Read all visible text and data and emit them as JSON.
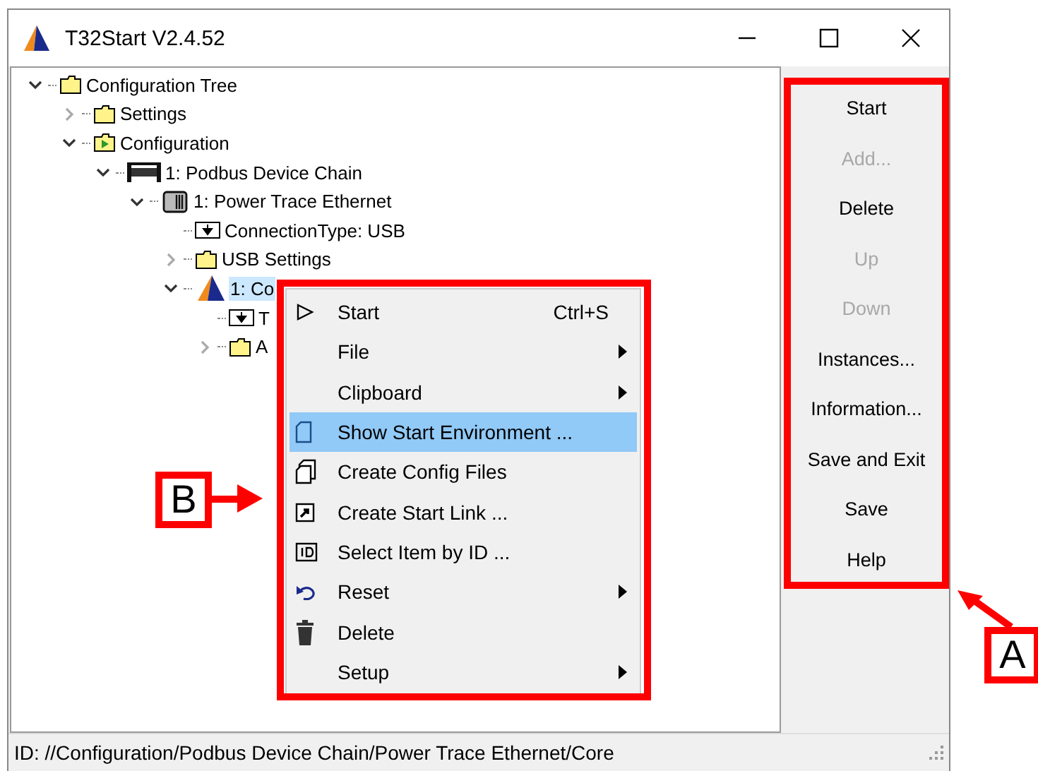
{
  "window": {
    "title": "T32Start V2.4.52"
  },
  "tree": [
    {
      "label": "Configuration Tree",
      "kind": "folder",
      "expanded": true,
      "selected": false,
      "children": [
        {
          "label": "Settings",
          "kind": "folder",
          "expanded": false,
          "selected": false
        },
        {
          "label": "Configuration",
          "kind": "folder-run",
          "expanded": true,
          "selected": false,
          "children": [
            {
              "label": "1: Podbus Device Chain",
              "kind": "chain",
              "expanded": true,
              "selected": false,
              "children": [
                {
                  "label": "1: Power Trace Ethernet",
                  "kind": "device",
                  "expanded": true,
                  "selected": false,
                  "children": [
                    {
                      "label": "ConnectionType: USB",
                      "kind": "setting",
                      "selected": false
                    },
                    {
                      "label": "USB Settings",
                      "kind": "folder",
                      "expanded": false,
                      "selected": false
                    },
                    {
                      "label": "1: Co",
                      "kind": "core",
                      "expanded": true,
                      "selected": true,
                      "children": [
                        {
                          "label": "T",
                          "kind": "setting",
                          "selected": false
                        },
                        {
                          "label": "A",
                          "kind": "folder",
                          "expanded": false,
                          "selected": false
                        }
                      ]
                    }
                  ]
                }
              ]
            }
          ]
        }
      ]
    }
  ],
  "context_menu": [
    {
      "label": "Start",
      "kind": "play",
      "shortcut": "Ctrl+S",
      "submenu": false,
      "selected": false
    },
    {
      "label": "File",
      "submenu": true,
      "selected": false
    },
    {
      "label": "Clipboard",
      "submenu": true,
      "selected": false
    },
    {
      "label": "Show Start Environment ...",
      "kind": "page",
      "submenu": false,
      "selected": true
    },
    {
      "label": "Create Config Files",
      "kind": "pages",
      "submenu": false,
      "selected": false
    },
    {
      "label": "Create Start Link ...",
      "kind": "link",
      "submenu": false,
      "selected": false
    },
    {
      "label": "Select Item by ID ...",
      "kind": "id",
      "submenu": false,
      "selected": false
    },
    {
      "label": "Reset",
      "kind": "undo",
      "submenu": true,
      "selected": false
    },
    {
      "label": "Delete",
      "kind": "trash",
      "submenu": false,
      "selected": false
    },
    {
      "label": "Setup",
      "submenu": true,
      "selected": false
    }
  ],
  "buttons": [
    {
      "label": "Start",
      "disabled": false
    },
    {
      "label": "Add...",
      "disabled": true
    },
    {
      "label": "Delete",
      "disabled": false
    },
    {
      "label": "Up",
      "disabled": true
    },
    {
      "label": "Down",
      "disabled": true
    },
    {
      "label": "Instances...",
      "disabled": false
    },
    {
      "label": "Information...",
      "disabled": false
    },
    {
      "label": "Save and Exit",
      "disabled": false
    },
    {
      "label": "Save",
      "disabled": false
    },
    {
      "label": "Help",
      "disabled": false
    }
  ],
  "status_bar": "ID: //Configuration/Podbus Device Chain/Power Trace Ethernet/Core",
  "annotations": [
    {
      "label": "B",
      "kind": "menu"
    },
    {
      "label": "A",
      "kind": "panel"
    }
  ]
}
